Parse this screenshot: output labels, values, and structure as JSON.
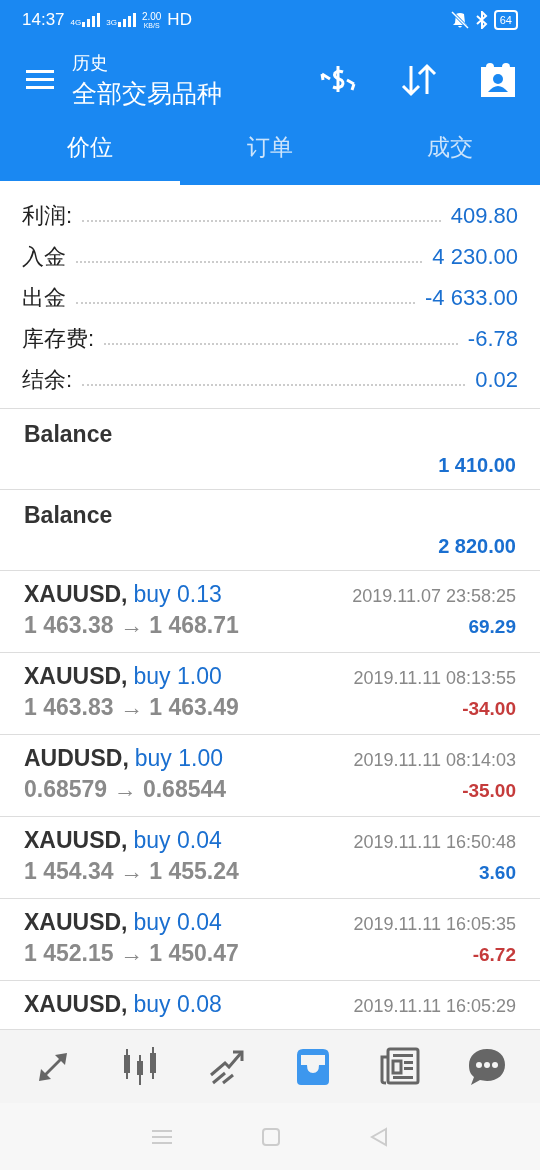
{
  "status_bar": {
    "time": "14:37",
    "signal_1": "4G",
    "signal_2": "3G",
    "speed": "2.00",
    "speed_unit": "KB/S",
    "hd": "HD",
    "battery": "64"
  },
  "header": {
    "subtitle": "历史",
    "title": "全部交易品种"
  },
  "tabs": [
    {
      "label": "价位",
      "selected": true
    },
    {
      "label": "订单",
      "selected": false
    },
    {
      "label": "成交",
      "selected": false
    }
  ],
  "summary": [
    {
      "label": "利润:",
      "value": "409.80"
    },
    {
      "label": "入金",
      "value": "4 230.00"
    },
    {
      "label": "出金",
      "value": "-4 633.00"
    },
    {
      "label": "库存费:",
      "value": "-6.78"
    },
    {
      "label": "结余:",
      "value": "0.02"
    }
  ],
  "balances": [
    {
      "label": "Balance",
      "amount": "1 410.00"
    },
    {
      "label": "Balance",
      "amount": "2 820.00"
    }
  ],
  "trades": [
    {
      "symbol": "XAUUSD,",
      "action": "buy 0.13",
      "prices": "1 463.38 → 1 468.71",
      "time": "2019.11.07 23:58:25",
      "profit": "69.29",
      "loss": false
    },
    {
      "symbol": "XAUUSD,",
      "action": "buy 1.00",
      "prices": "1 463.83 → 1 463.49",
      "time": "2019.11.11 08:13:55",
      "profit": "-34.00",
      "loss": true
    },
    {
      "symbol": "AUDUSD,",
      "action": "buy 1.00",
      "prices": "0.68579 → 0.68544",
      "time": "2019.11.11 08:14:03",
      "profit": "-35.00",
      "loss": true
    },
    {
      "symbol": "XAUUSD,",
      "action": "buy 0.04",
      "prices": "1 454.34 → 1 455.24",
      "time": "2019.11.11 16:50:48",
      "profit": "3.60",
      "loss": false
    },
    {
      "symbol": "XAUUSD,",
      "action": "buy 0.04",
      "prices": "1 452.15 → 1 450.47",
      "time": "2019.11.11 16:05:35",
      "profit": "-6.72",
      "loss": true
    },
    {
      "symbol": "XAUUSD,",
      "action": "buy 0.08",
      "time": "2019.11.11 16:05:29"
    }
  ],
  "bottom_nav": [
    {
      "kind": "quotes",
      "selected": false
    },
    {
      "kind": "chart",
      "selected": false
    },
    {
      "kind": "trade",
      "selected": false
    },
    {
      "kind": "history",
      "selected": true
    },
    {
      "kind": "news",
      "selected": false
    },
    {
      "kind": "chat",
      "selected": false
    }
  ]
}
